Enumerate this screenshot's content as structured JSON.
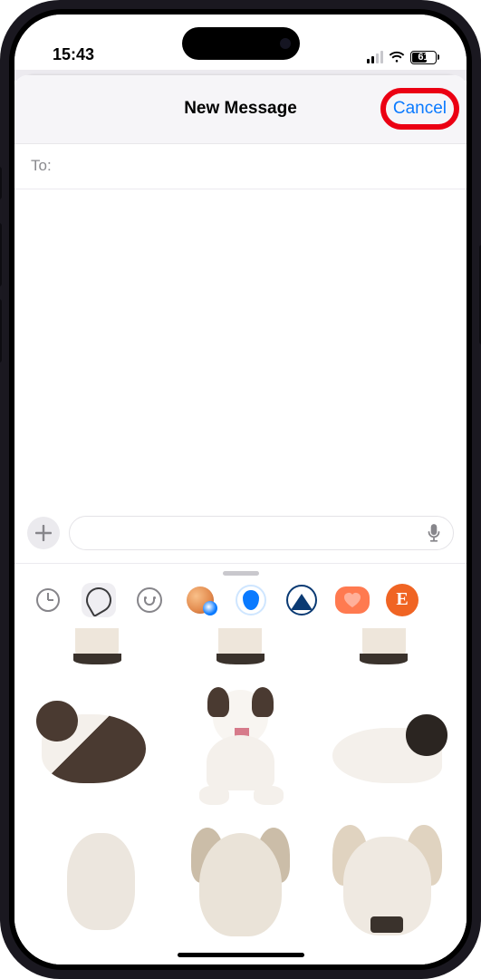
{
  "status": {
    "time": "15:43",
    "battery_pct": "61",
    "signal_active_bars": 2,
    "signal_total_bars": 4
  },
  "nav": {
    "title": "New Message",
    "cancel_label": "Cancel"
  },
  "compose": {
    "to_label": "To:",
    "to_value": "",
    "message_placeholder": "",
    "message_value": ""
  },
  "app_drawer": {
    "items": [
      {
        "name": "recents",
        "icon": "clock"
      },
      {
        "name": "stickers",
        "icon": "shape",
        "selected": true
      },
      {
        "name": "memoji-smiley",
        "icon": "smiley"
      },
      {
        "name": "memoji-avatar",
        "icon": "memoji"
      },
      {
        "name": "hydration-app",
        "icon": "drop"
      },
      {
        "name": "peaks-app",
        "icon": "peak"
      },
      {
        "name": "heart-app",
        "icon": "heart"
      },
      {
        "name": "etsy-app",
        "icon": "etsy",
        "label": "E"
      }
    ]
  },
  "stickers": {
    "visible": [
      "dog-pair-playing",
      "dog-front-tongue-out",
      "dog-side-harness",
      "dog-head-tan",
      "dog-head-ears-up",
      "dog-head-teeth"
    ]
  },
  "annotation": {
    "highlight_target": "cancel-button"
  }
}
